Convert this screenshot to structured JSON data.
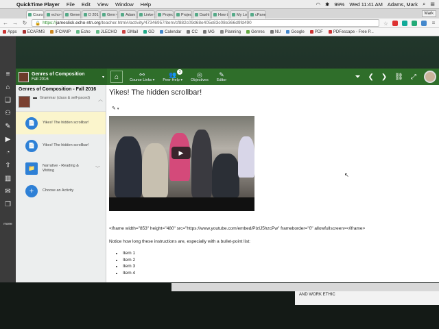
{
  "menubar": {
    "app_name": "QuickTime Player",
    "menus": [
      "File",
      "Edit",
      "View",
      "Window",
      "Help"
    ],
    "battery": "99%",
    "clock": "Wed 11:41 AM",
    "user": "Adams, Mark"
  },
  "browser": {
    "tabs": [
      "Cours",
      "echo",
      "Gener",
      "D 201",
      "Genr",
      "Adam",
      "Linke",
      "Projec",
      "Projec",
      "Dashl",
      "How t",
      "My Lo",
      "cPane"
    ],
    "profile": "Mark",
    "url_scheme": "https://",
    "url_host": "jameslick.echo-ntn.org",
    "url_path": "/teacher.html#/activity/47346957/item/cf882c09d68e405e83c08e366d9fd490",
    "bookmarks": [
      "Apps",
      "ECARMS",
      "IFCAMP",
      "Echo",
      "JLECHO",
      "GMail",
      "GD",
      "Calendar",
      "CC",
      "MG",
      "Planning",
      "Genres",
      "NU",
      "Google",
      "PDF",
      "PDFescape - Free P..."
    ]
  },
  "app": {
    "course_title": "Genres of Composition",
    "course_term": "Fall 2016",
    "tools": [
      {
        "icon": "⌂",
        "label": ""
      },
      {
        "icon": "⚯",
        "label": "Course Links ▾"
      },
      {
        "icon": "👥",
        "label": "Peer Help ▾"
      },
      {
        "icon": "◎",
        "label": "Objectives"
      },
      {
        "icon": "✎",
        "label": "Editor"
      }
    ],
    "peer_help_badge": "3",
    "sidebar": {
      "title": "Genres of Composition - Fall 2016",
      "unit_label": "Grammar (class & self-paced)",
      "activities": [
        {
          "label": "Yikes! The hidden scrollbar!",
          "icon": "📄",
          "selected": true
        },
        {
          "label": "Yikes! The hidden scrollbar!",
          "icon": "📄",
          "selected": false
        },
        {
          "label": "Narrative - Reading & Writing",
          "icon": "📁",
          "selected": false
        },
        {
          "label": "Choose an Activity",
          "icon": "+",
          "selected": false
        }
      ]
    },
    "main": {
      "title": "Yikes! The hidden scrollbar!",
      "iframe_code": "<iframe width=\"853\" height=\"480\" src=\"https://www.youtube.com/embed/PlzIJ5hzcPw\" frameborder=\"0\" allowfullscreen></iframe>",
      "notice": "Notice how long these instructions are, especially with a bullet-point list:",
      "items": [
        "Item 1",
        "Item 2",
        "Item 3",
        "Item 4"
      ]
    }
  },
  "rail": {
    "more_label": "more"
  },
  "background_doc": {
    "line1": "AND WORK ETHIC"
  }
}
